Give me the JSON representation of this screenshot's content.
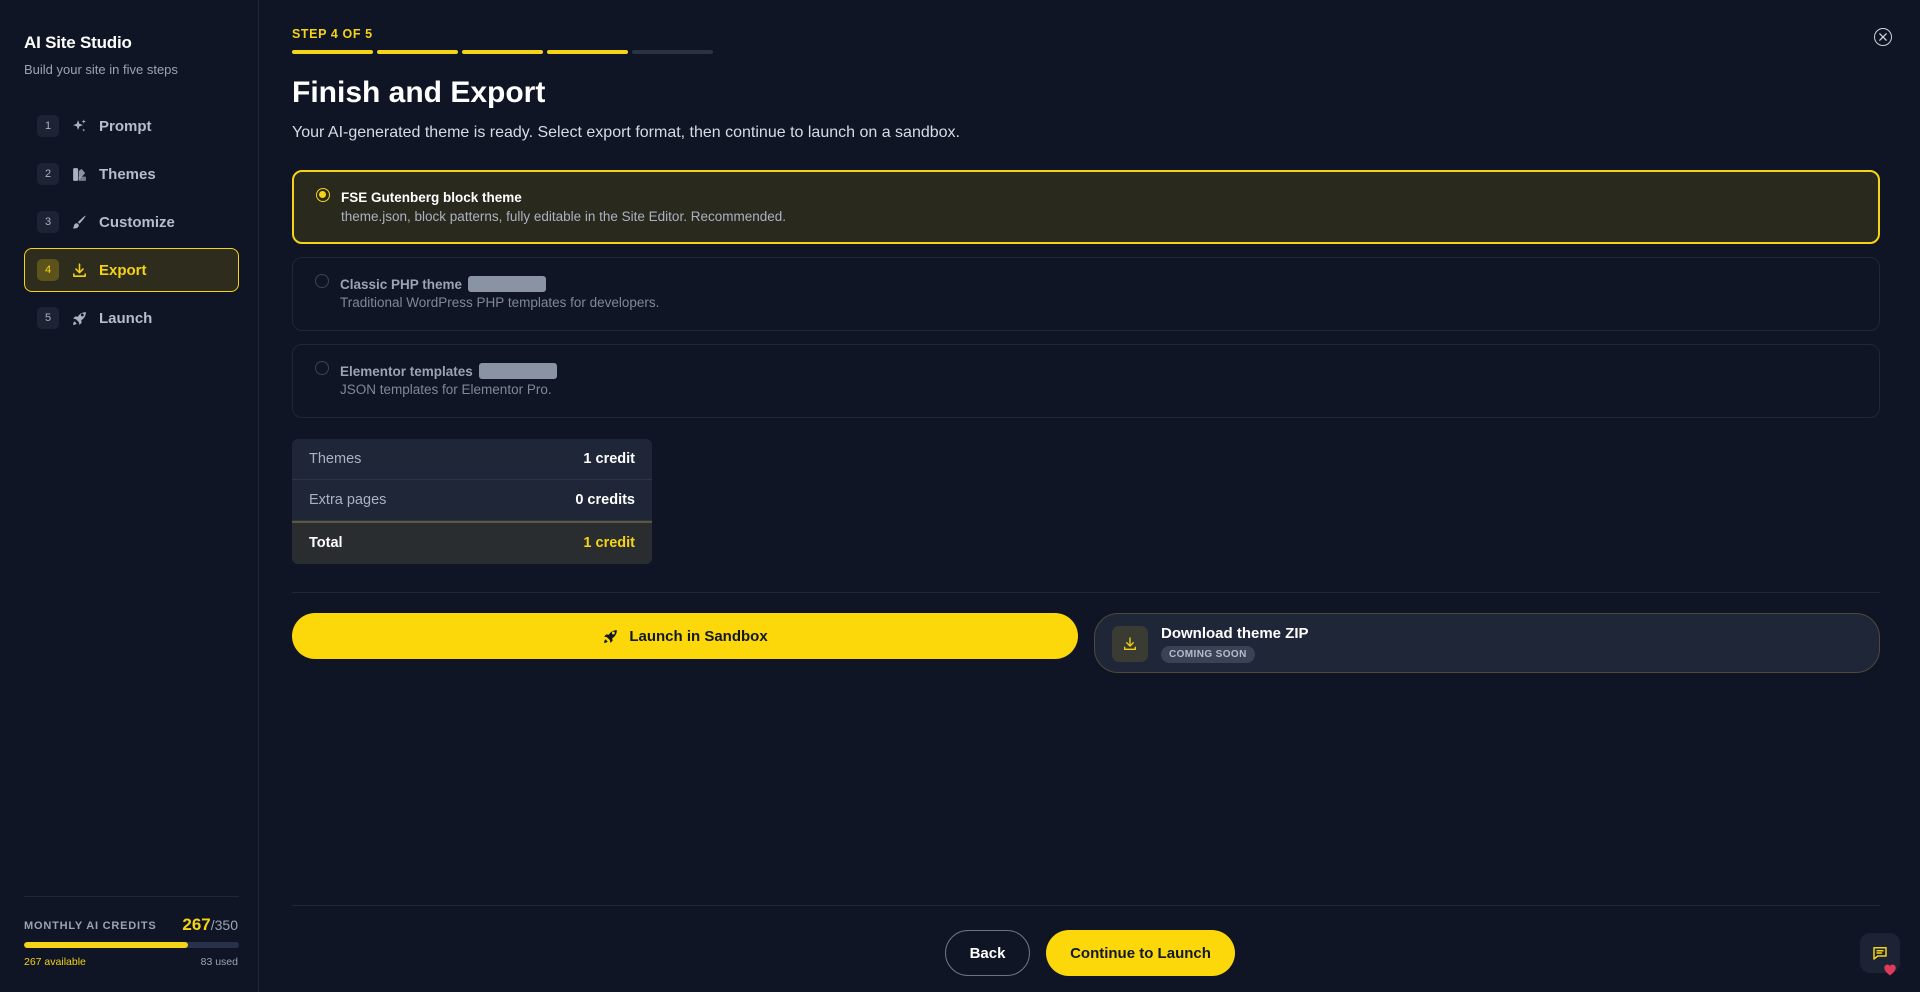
{
  "sidebar": {
    "title": "AI Site Studio",
    "subtitle": "Build your site in five steps",
    "items": [
      {
        "num": "1",
        "label": "Prompt",
        "icon": "sparkles-icon"
      },
      {
        "num": "2",
        "label": "Themes",
        "icon": "palette-icon"
      },
      {
        "num": "3",
        "label": "Customize",
        "icon": "brush-icon"
      },
      {
        "num": "4",
        "label": "Export",
        "icon": "download-icon",
        "active": true
      },
      {
        "num": "5",
        "label": "Launch",
        "icon": "rocket-icon"
      }
    ],
    "credits": {
      "label": "MONTHLY AI CREDITS",
      "value": "267",
      "total": "/350",
      "fraction": 0.763,
      "available": "267 available",
      "used": "83 used"
    }
  },
  "header": {
    "step_label": "STEP 4 OF 5",
    "steps_total": 5,
    "steps_done": 4
  },
  "main": {
    "title": "Finish and Export",
    "description": "Your AI-generated theme is ready. Select export format, then continue to launch on a sandbox.",
    "options": [
      {
        "title": "FSE Gutenberg block theme",
        "desc": "theme.json, block patterns, fully editable in the Site Editor. Recommended.",
        "selected": true
      },
      {
        "title": "Classic PHP theme",
        "desc": "Traditional WordPress PHP templates for developers.",
        "selected": false
      },
      {
        "title": "Elementor templates",
        "desc": "JSON templates for Elementor Pro.",
        "selected": false
      }
    ],
    "cost": {
      "rows": [
        {
          "label": "Themes",
          "value": "1 credit"
        },
        {
          "label": "Extra pages",
          "value": "0 credits"
        }
      ],
      "total_label": "Total",
      "total_value": "1 credit"
    },
    "launch_label": "Launch in Sandbox",
    "download": {
      "title": "Download theme ZIP",
      "badge": "COMING SOON"
    }
  },
  "footer": {
    "back_label": "Back",
    "continue_label": "Continue to Launch"
  },
  "colors": {
    "accent": "#f5d317",
    "background": "#0f1524",
    "panel": "#1e2638"
  }
}
